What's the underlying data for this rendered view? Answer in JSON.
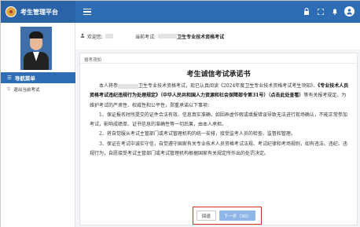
{
  "header": {
    "app_title": "考生管理平台",
    "icons": [
      "lock-icon",
      "fullscreen-icon",
      "bell-icon",
      "user-avatar-icon"
    ]
  },
  "sidebar": {
    "nav_header": "导航菜单",
    "items": [
      {
        "label": "退出当前考试",
        "icon": "logout-icon"
      }
    ]
  },
  "info": {
    "welcome_label": "欢迎您:",
    "exam_label": "当前考试:",
    "exam_name": "卫生专业技术资格考试"
  },
  "notice": {
    "tab_label": "报考须知",
    "title": "考生诚信考试承诺书",
    "p1_a": "本人将参",
    "p1_b": "卫生专业技术资格考试，现已认真阅读《2024年度卫生专业技术资格考试考生须知》、",
    "p1_c": "《专业技术人员资格考试违纪违规行为处理规定》（中华人民共和国人力资源和社会保障部令第31号）",
    "p1_d": "（点击此处查看）",
    "p1_e": "等有关报考规定，为维护考试的严肃性、权威性和公平性，郑重承诺以下事项：",
    "p2": "1、保证报名时所提交的证件合法有效、信息真实准确，如因弄虚作假或填报错误导致无法进行现场确认，不能正常参加考试，影响成绩单、证书信息的准确性等一切后果，由本人承担。",
    "p3": "2、将自觉服从考试主管部门或考试管理机构的统一安排，接受监考人员的检查、监督和管理。",
    "p4": "3、保证在考试中诚实守信，自觉遵守国家有关专业技术人员资格考试法规、考试纪律和考场规则，如有违法、违纪、违规行为，自愿接受考试主管部门或考试管理机构根据国家有关规定所作出的处罚决定。"
  },
  "buttons": {
    "back": "回退",
    "next": "下一步（30）"
  }
}
